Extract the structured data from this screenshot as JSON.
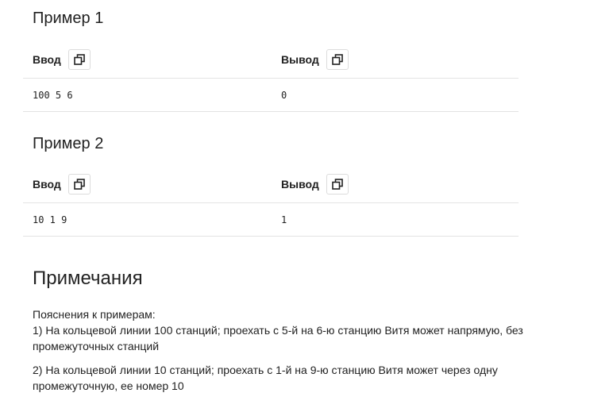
{
  "examples": [
    {
      "title": "Пример 1",
      "input_label": "Ввод",
      "output_label": "Вывод",
      "input_value": "100 5 6",
      "output_value": "0",
      "copy_icon": "copy-icon"
    },
    {
      "title": "Пример 2",
      "input_label": "Ввод",
      "output_label": "Вывод",
      "input_value": "10 1 9",
      "output_value": "1",
      "copy_icon": "copy-icon"
    }
  ],
  "notes": {
    "title": "Примечания",
    "intro": "Пояснения к примерам:",
    "line1": "1) На кольцевой линии 100 станций; проехать с 5-й на 6-ю станцию Витя может напрямую, без промежуточных станций",
    "line2": "2) На кольцевой линии 10 станций; проехать с 1-й на 9-ю станцию Витя может через одну промежуточную, ее номер 10"
  }
}
